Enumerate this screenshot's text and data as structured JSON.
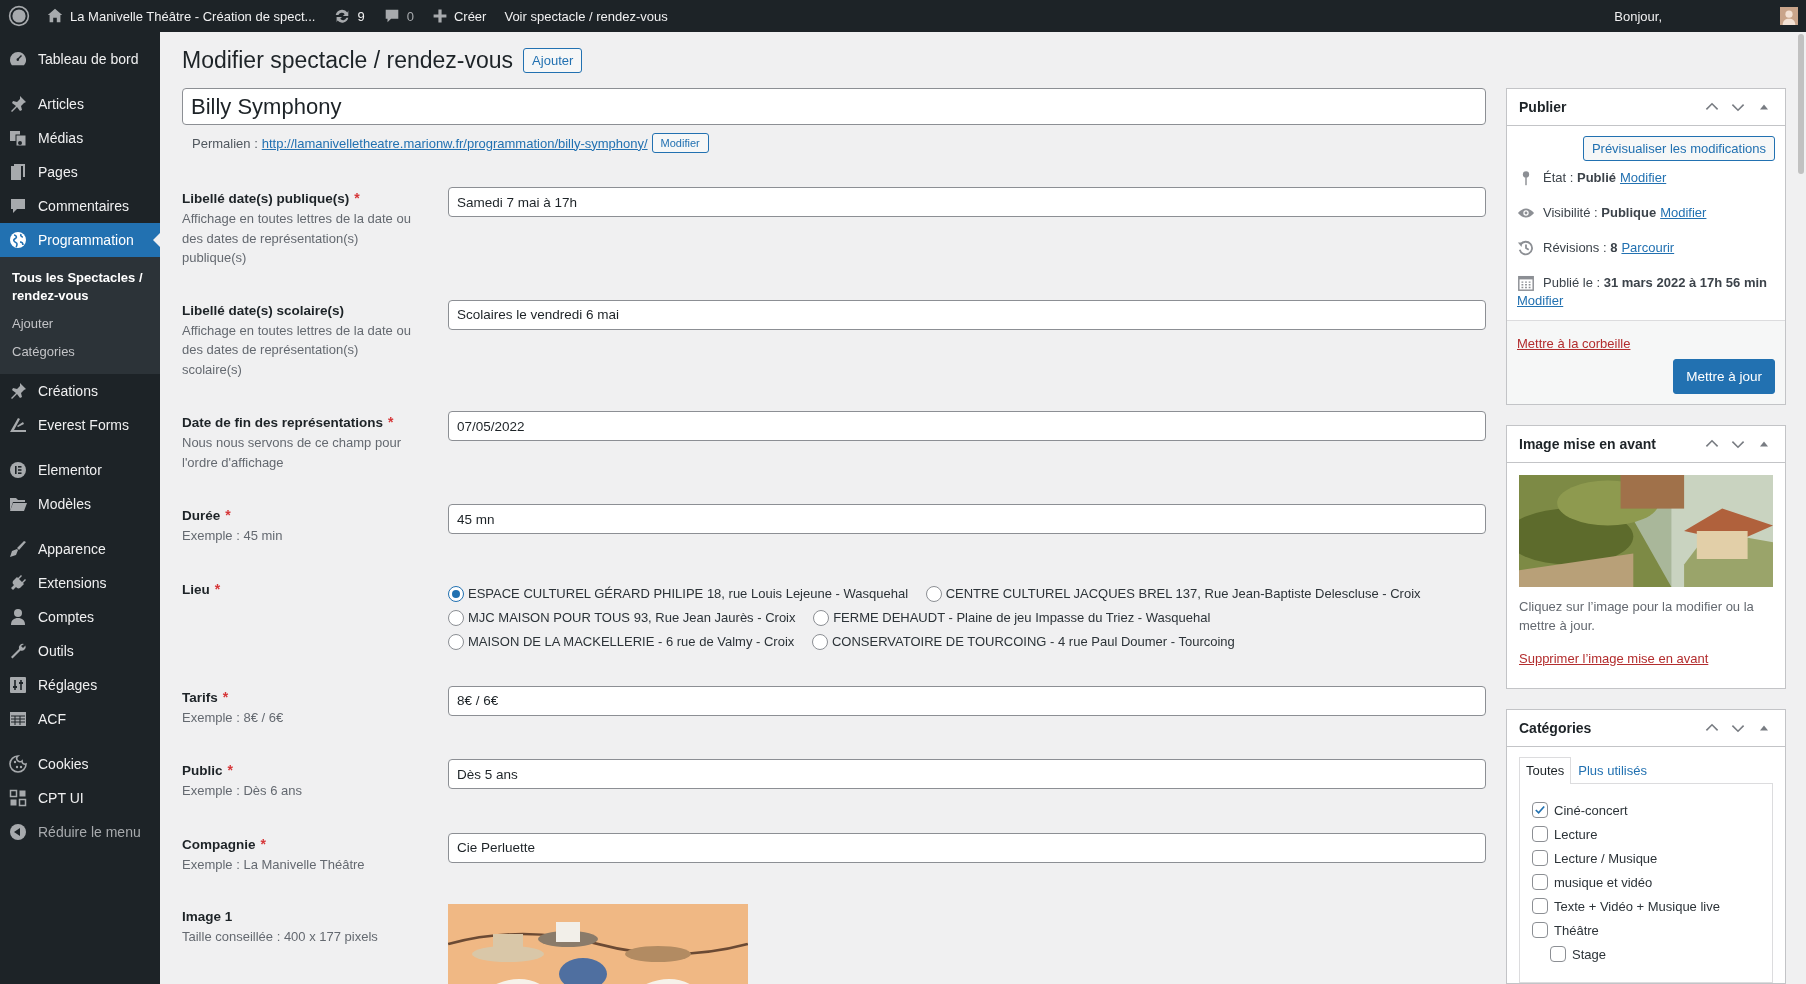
{
  "admin_bar": {
    "site_name": "La Manivelle Théâtre - Création de spect...",
    "updates_count": "9",
    "comments_count": "0",
    "new_label": "Créer",
    "view_link": "Voir spectacle / rendez-vous",
    "greeting": "Bonjour,"
  },
  "sidebar": {
    "groups": [
      [
        {
          "label": "Tableau de bord",
          "selected": false
        }
      ],
      [
        {
          "label": "Articles",
          "selected": false
        },
        {
          "label": "Médias",
          "selected": false
        },
        {
          "label": "Pages",
          "selected": false
        },
        {
          "label": "Commentaires",
          "selected": false
        },
        {
          "label": "Programmation",
          "selected": true,
          "children": [
            {
              "label": "Tous les Spectacles / rendez-vous",
              "selected": true
            },
            {
              "label": "Ajouter",
              "selected": false
            },
            {
              "label": "Catégories",
              "selected": false
            }
          ]
        },
        {
          "label": "Créations",
          "selected": false
        },
        {
          "label": "Everest Forms",
          "selected": false
        }
      ],
      [
        {
          "label": "Elementor",
          "selected": false
        },
        {
          "label": "Modèles",
          "selected": false
        }
      ],
      [
        {
          "label": "Apparence",
          "selected": false
        },
        {
          "label": "Extensions",
          "selected": false
        },
        {
          "label": "Comptes",
          "selected": false
        },
        {
          "label": "Outils",
          "selected": false
        },
        {
          "label": "Réglages",
          "selected": false
        },
        {
          "label": "ACF",
          "selected": false
        }
      ],
      [
        {
          "label": "Cookies",
          "selected": false
        },
        {
          "label": "CPT UI",
          "selected": false
        }
      ]
    ],
    "collapse_label": "Réduire le menu"
  },
  "page": {
    "title": "Modifier spectacle / rendez-vous",
    "add_button": "Ajouter",
    "post_title": "Billy Symphony",
    "permalink": {
      "label": "Permalien :",
      "url": "http://lamanivelletheatre.marionw.fr/programmation/billy-symphony/",
      "edit_button": "Modifier"
    }
  },
  "fields": [
    {
      "kind": "text",
      "label": "Libellé date(s) publique(s)",
      "required_mark": "*",
      "description": "Affichage en toutes lettres de la date ou des dates de représentation(s) publique(s)",
      "value": "Samedi 7 mai à 17h"
    },
    {
      "kind": "text",
      "label": "Libellé date(s) scolaire(s)",
      "description": "Affichage en toutes lettres de la date ou des dates de représentation(s) scolaire(s)",
      "value": "Scolaires le vendredi 6 mai"
    },
    {
      "kind": "text",
      "label": "Date de fin des représentations",
      "required_mark": "*",
      "description": "Nous nous servons de ce champ pour l'ordre d'affichage",
      "value": "07/05/2022"
    },
    {
      "kind": "text",
      "label": "Durée",
      "required_mark": "*",
      "description": "Exemple : 45 min",
      "value": "45 mn"
    },
    {
      "kind": "radio",
      "label": "Lieu",
      "required_mark": "*",
      "options": [
        {
          "label": "ESPACE CULTUREL GÉRARD PHILIPE 18, rue Louis Lejeune - Wasquehal",
          "selected": true
        },
        {
          "label": "CENTRE CULTUREL JACQUES BREL 137, Rue Jean-Baptiste Delescluse - Croix",
          "selected": false
        },
        {
          "label": "MJC MAISON POUR TOUS 93, Rue Jean Jaurès - Croix",
          "selected": false
        },
        {
          "label": "FERME DEHAUDT - Plaine de jeu Impasse du Triez - Wasquehal",
          "selected": false
        },
        {
          "label": "MAISON DE LA MACKELLERIE - 6 rue de Valmy - Croix",
          "selected": false
        },
        {
          "label": "CONSERVATOIRE DE TOURCOING - 4 rue Paul Doumer - Tourcoing",
          "selected": false
        }
      ]
    },
    {
      "kind": "text",
      "label": "Tarifs",
      "required_mark": "*",
      "description": "Exemple : 8€ / 6€",
      "value": "8€ / 6€"
    },
    {
      "kind": "text",
      "label": "Public",
      "required_mark": "*",
      "description": "Exemple : Dès 6 ans",
      "value": "Dès 5 ans"
    },
    {
      "kind": "text",
      "label": "Compagnie",
      "required_mark": "*",
      "description": "Exemple : La Manivelle Théâtre",
      "value": "Cie Perluette"
    },
    {
      "label": "Image 1",
      "description": "Taille conseillée : 400 x 177 pixels"
    }
  ],
  "publish_box": {
    "title": "Publier",
    "preview_button": "Prévisualiser les modifications",
    "rows": [
      {
        "kind": "status",
        "label": "État :",
        "value": "Publié",
        "link": "Modifier"
      },
      {
        "kind": "visibility",
        "label": "Visibilité :",
        "value": "Publique",
        "link": "Modifier"
      },
      {
        "kind": "revisions",
        "label": "Révisions :",
        "value": "8",
        "link": "Parcourir"
      },
      {
        "kind": "date",
        "label": "Publié le :",
        "value": "31 mars 2022 à 17h 56 min",
        "link": "Modifier"
      }
    ],
    "trash_link": "Mettre à la corbeille",
    "update_button": "Mettre à jour"
  },
  "featured_image_box": {
    "title": "Image mise en avant",
    "hint": "Cliquez sur l’image pour la modifier ou la mettre à jour.",
    "remove_link": "Supprimer l’image mise en avant"
  },
  "categories_box": {
    "title": "Catégories",
    "tabs": [
      {
        "label": "Toutes",
        "selected": true
      },
      {
        "label": "Plus utilisés",
        "selected": false
      }
    ],
    "items": [
      {
        "label": "Ciné-concert",
        "checked": true
      },
      {
        "label": "Lecture",
        "checked": false
      },
      {
        "label": "Lecture / Musique",
        "checked": false
      },
      {
        "label": "musique et vidéo",
        "checked": false
      },
      {
        "label": "Texte + Vidéo + Musique live",
        "checked": false
      },
      {
        "label": "Théâtre",
        "checked": false,
        "children": [
          {
            "label": "Stage",
            "checked": false
          }
        ]
      }
    ]
  }
}
